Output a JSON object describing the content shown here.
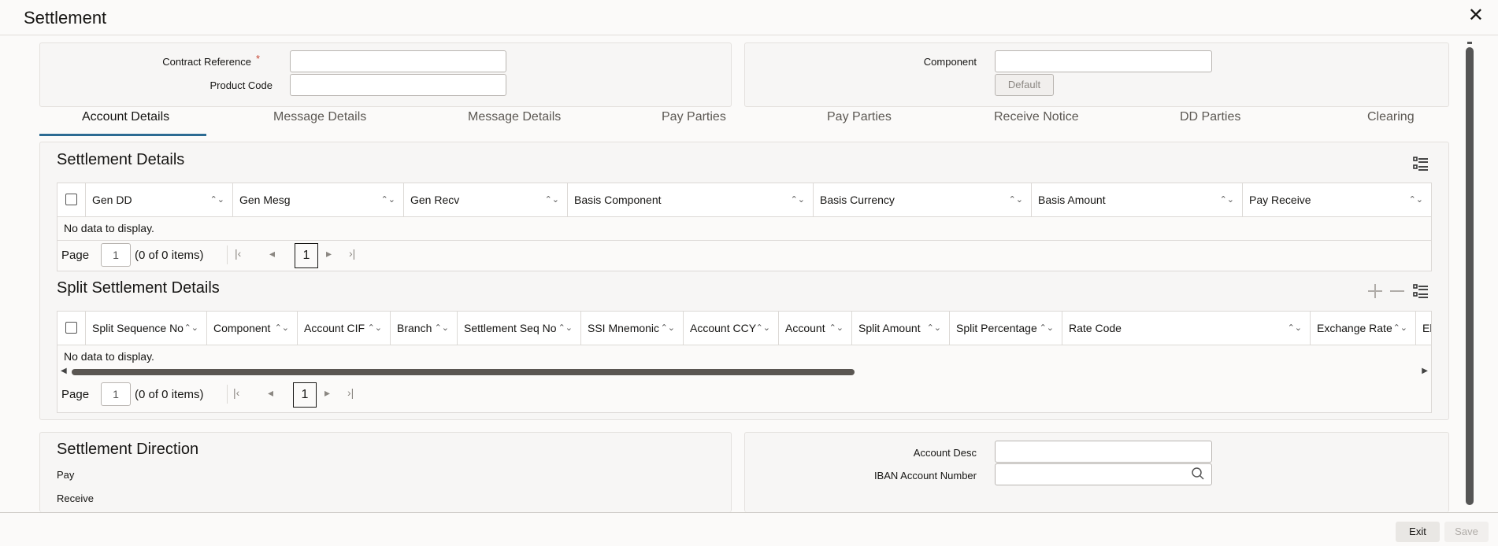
{
  "window": {
    "title": "Settlement",
    "close_label": "✕"
  },
  "header_form": {
    "contract_reference_label": "Contract Reference",
    "required_mark": "*",
    "contract_reference_value": "",
    "product_code_label": "Product Code",
    "product_code_value": "",
    "component_label": "Component",
    "component_value": "",
    "default_button": "Default"
  },
  "tabs": [
    {
      "label": "Account Details",
      "active": true
    },
    {
      "label": "Message Details"
    },
    {
      "label": "Message Details"
    },
    {
      "label": "Pay Parties"
    },
    {
      "label": "Pay Parties"
    },
    {
      "label": "Receive Notice"
    },
    {
      "label": "DD Parties"
    },
    {
      "label": "Clearing"
    }
  ],
  "settlement_details": {
    "title": "Settlement Details",
    "columns": [
      "Gen DD",
      "Gen Mesg",
      "Gen Recv",
      "Basis Component",
      "Basis Currency",
      "Basis Amount",
      "Pay Receive"
    ],
    "no_data": "No data to display.",
    "pager": {
      "page_label": "Page",
      "page_input": "1",
      "count": "(0 of 0 items)",
      "current": "1"
    }
  },
  "split_settlement": {
    "title": "Split Settlement Details",
    "columns": [
      "Split Sequence No",
      "Component",
      "Account CIF",
      "Branch",
      "Settlement Seq No",
      "SSI Mnemonic",
      "Account CCY",
      "Account",
      "Split Amount",
      "Split Percentage",
      "Rate Code",
      "Exchange Rate",
      "El"
    ],
    "no_data": "No data to display.",
    "pager": {
      "page_label": "Page",
      "page_input": "1",
      "count": "(0 of 0 items)",
      "current": "1"
    }
  },
  "settlement_direction": {
    "title": "Settlement Direction",
    "pay_label": "Pay",
    "receive_label": "Receive",
    "account_desc_label": "Account Desc",
    "account_desc_value": "",
    "iban_label": "IBAN Account Number",
    "iban_value": ""
  },
  "footer": {
    "exit_label": "Exit",
    "save_label": "Save"
  },
  "icons": [
    "close-icon",
    "sort-icon",
    "checkbox-icon",
    "first-page-icon",
    "prev-page-icon",
    "next-page-icon",
    "last-page-icon",
    "column-list-icon",
    "add-icon",
    "remove-icon",
    "search-icon"
  ],
  "colors": {
    "accent": "#2c6b93",
    "required": "#c74634",
    "background": "#fbfaf9"
  }
}
